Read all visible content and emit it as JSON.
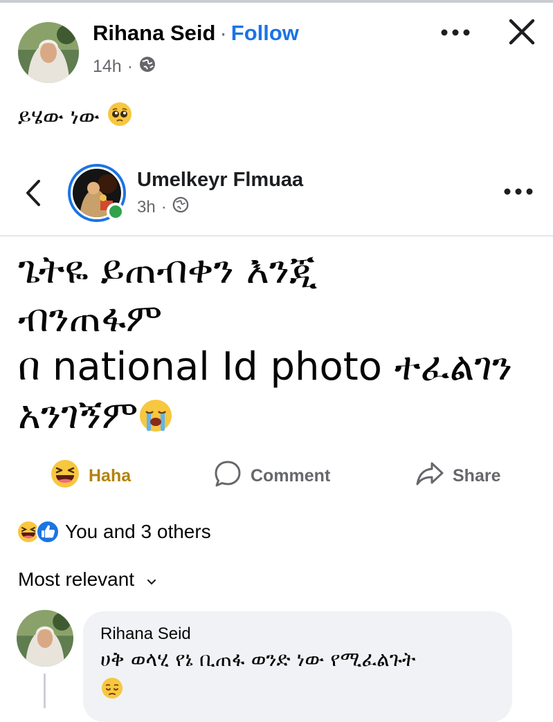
{
  "outer_post": {
    "author": "Rihana Seid",
    "separator": "·",
    "follow_label": "Follow",
    "time": "14h",
    "audience_icon": "globe-icon",
    "text": "ይሄው ነው",
    "text_emoji": "pleading-face-emoji"
  },
  "shared_post": {
    "author": "Umelkeyr Flmuaa",
    "time": "3h",
    "separator": "·",
    "audience_icon": "globe-icon",
    "lines": [
      "ጌትዬ ይጠብቀን እንጂ",
      "ብንጠፋም",
      " በ national Id photo ተፈልገን",
      "አንገኝም"
    ],
    "end_emoji": "loudly-crying-face-emoji"
  },
  "actions": {
    "haha_label": "Haha",
    "comment_label": "Comment",
    "share_label": "Share"
  },
  "reactions": {
    "summary": "You and 3 others",
    "icons": [
      "haha-reaction-icon",
      "like-reaction-icon"
    ]
  },
  "comments_sort": {
    "label": "Most relevant"
  },
  "comment": {
    "author": "Rihana Seid",
    "text": "ሀቅ ወላሂ የኔ ቢጠፋ ወንድ ነው የሚፈልጉት",
    "emoji": "pensive-face-emoji"
  },
  "colors": {
    "accent_blue": "#1b74e4",
    "haha_gold": "#b3820b",
    "secondary_text": "#65676b",
    "online_green": "#31a24c",
    "bubble_bg": "#f0f2f5"
  }
}
